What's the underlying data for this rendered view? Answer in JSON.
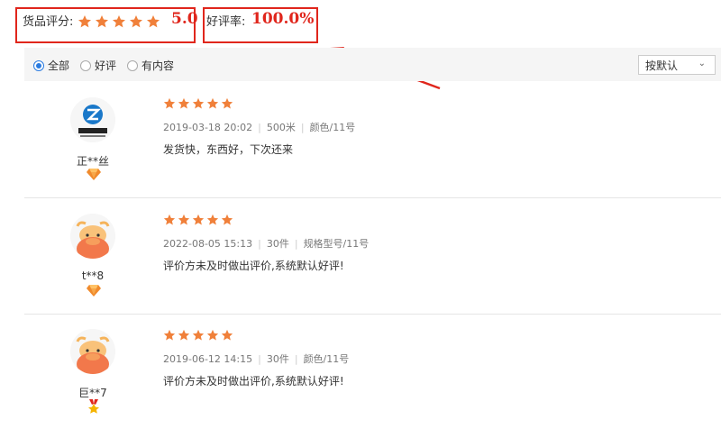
{
  "summary": {
    "score_label": "货品评分:",
    "score_value": "5.0",
    "score_stars": 5,
    "rate_label": "好评率:",
    "rate_value": "100.0%"
  },
  "filters": {
    "all": "全部",
    "good": "好评",
    "with_content": "有内容",
    "selected": "全部"
  },
  "sort": {
    "label": "按默认"
  },
  "reviews": [
    {
      "username": "正**丝",
      "avatar": "zhengmei-logo-icon",
      "level_icon": "diamond-icon",
      "stars": 5,
      "date": "2019-03-18 20:02",
      "quantity": "500米",
      "spec": "颜色/11号",
      "content": "发货快，东西好，下次还来"
    },
    {
      "username": "t**8",
      "avatar": "cow-avatar-icon",
      "level_icon": "diamond-icon",
      "stars": 5,
      "date": "2022-08-05 15:13",
      "quantity": "30件",
      "spec": "规格型号/11号",
      "content": "评价方未及时做出评价,系统默认好评!"
    },
    {
      "username": "巨**7",
      "avatar": "cow-avatar-icon",
      "level_icon": "medal-icon",
      "stars": 5,
      "date": "2019-06-12 14:15",
      "quantity": "30件",
      "spec": "颜色/11号",
      "content": "评价方未及时做出评价,系统默认好评!"
    }
  ],
  "colors": {
    "accent_red": "#e0261c",
    "star_orange": "#f0803a",
    "radio_blue": "#2a7be0"
  }
}
